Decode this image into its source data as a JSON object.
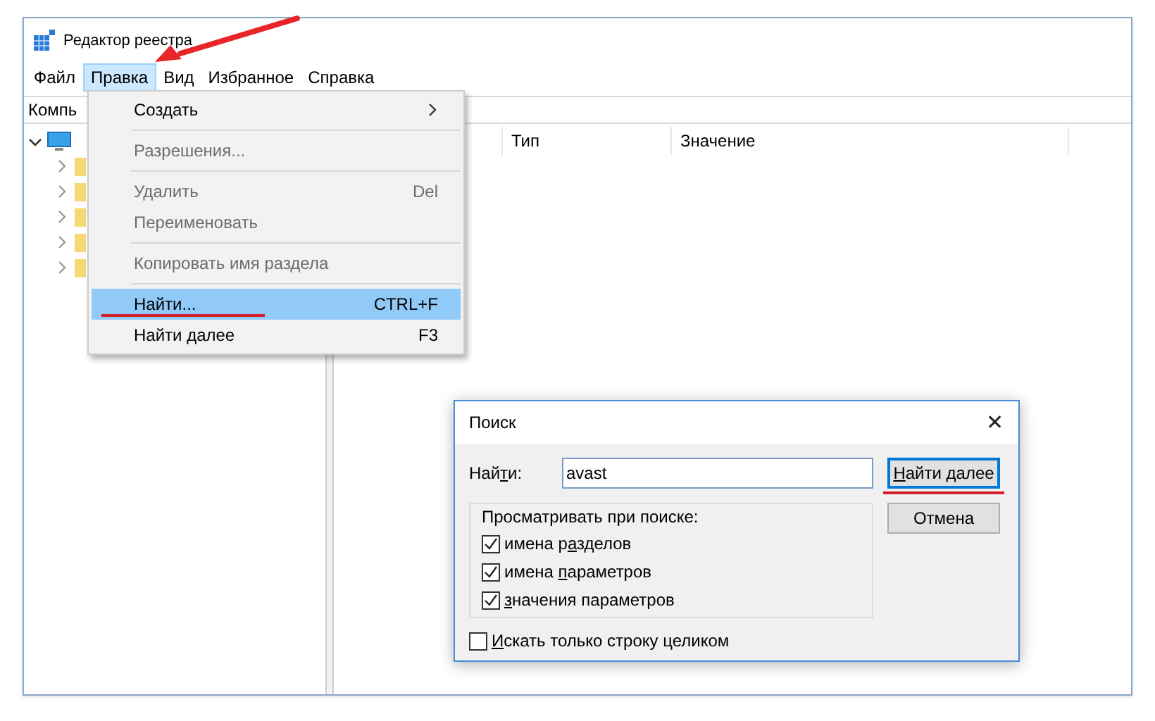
{
  "window": {
    "title": "Редактор реестра"
  },
  "menubar": [
    {
      "label": "Файл",
      "selected": false
    },
    {
      "label": "Правка",
      "selected": true
    },
    {
      "label": "Вид",
      "selected": false
    },
    {
      "label": "Избранное",
      "selected": false
    },
    {
      "label": "Справка",
      "selected": false
    }
  ],
  "address": "Компь",
  "tree": {
    "expanded": true,
    "children": [
      {
        "expanded": false
      },
      {
        "expanded": false
      },
      {
        "expanded": false
      },
      {
        "expanded": false
      },
      {
        "expanded": false
      }
    ]
  },
  "columns": [
    "Тип",
    "Значение"
  ],
  "menu": [
    {
      "kind": "item",
      "label": "Создать",
      "submenu": true,
      "disabled": false,
      "selected": false
    },
    {
      "kind": "separator"
    },
    {
      "kind": "item",
      "label": "Разрешения...",
      "submenu": false,
      "disabled": true,
      "selected": false
    },
    {
      "kind": "separator"
    },
    {
      "kind": "item",
      "label": "Удалить",
      "shortcut": "Del",
      "submenu": false,
      "disabled": true,
      "selected": false
    },
    {
      "kind": "item",
      "label": "Переименовать",
      "submenu": false,
      "disabled": true,
      "selected": false
    },
    {
      "kind": "separator"
    },
    {
      "kind": "item",
      "label": "Копировать имя раздела",
      "submenu": false,
      "disabled": true,
      "selected": false
    },
    {
      "kind": "separator"
    },
    {
      "kind": "item",
      "label": "Найти...",
      "shortcut": "CTRL+F",
      "submenu": false,
      "disabled": false,
      "selected": true
    },
    {
      "kind": "item",
      "label": "Найти далее",
      "shortcut": "F3",
      "submenu": false,
      "disabled": false,
      "selected": false
    }
  ],
  "dialog": {
    "title": "Поиск",
    "close": "✕",
    "find_label": {
      "pre": "Най",
      "key": "т",
      "post": "и:"
    },
    "find_value": "avast",
    "find_next": {
      "key": "Н",
      "post": "айти далее"
    },
    "cancel": "Отмена",
    "group_title": "Просматривать при поиске:",
    "options": [
      {
        "label": {
          "pre": "имена р",
          "key": "а",
          "post": "зделов"
        },
        "checked": true
      },
      {
        "label": {
          "pre": "имена ",
          "key": "п",
          "post": "араметров"
        },
        "checked": true
      },
      {
        "label": {
          "key": "з",
          "post": "начения параметров"
        },
        "checked": true
      }
    ],
    "whole_string": {
      "label": {
        "key": "И",
        "post": "скать только строку целиком"
      },
      "checked": false
    }
  }
}
